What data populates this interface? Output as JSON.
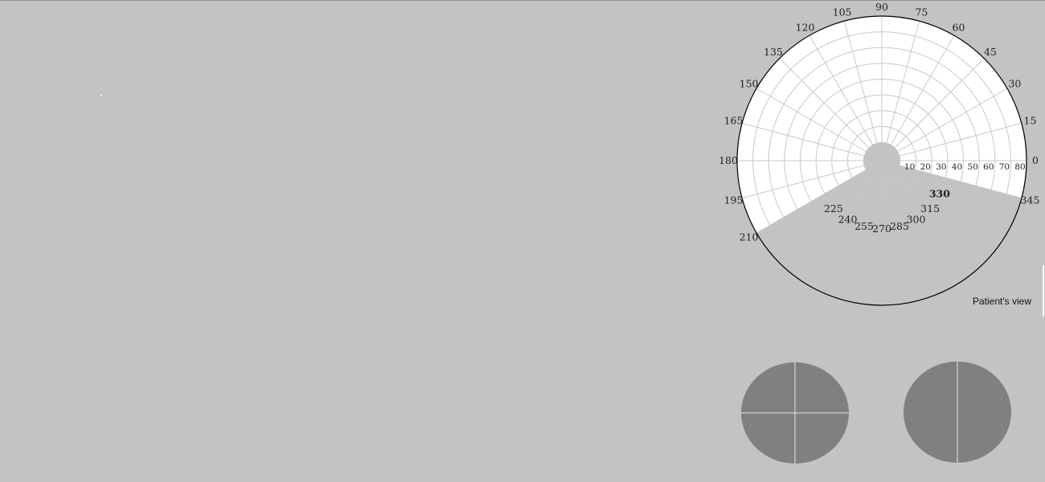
{
  "perimeter": {
    "angle_labels": [
      "0",
      "15",
      "30",
      "45",
      "60",
      "75",
      "90",
      "105",
      "120",
      "135",
      "150",
      "165",
      "180",
      "195",
      "210",
      "225",
      "240",
      "255",
      "270",
      "285",
      "300",
      "315",
      "330",
      "345"
    ],
    "highlighted_angle": "330",
    "radius_labels": [
      "10",
      "20",
      "30",
      "40",
      "50",
      "60",
      "70",
      "80"
    ],
    "view_label": "Patient's view",
    "tested_arc_degrees": [
      210,
      345
    ],
    "colors": {
      "background": "#c3c3c3",
      "field": "#ffffff",
      "grid": "#c8c8c8",
      "rim": "#000000",
      "eye_fill": "#808080"
    }
  },
  "eyes": [
    {
      "name": "left-eye",
      "crosshair": "cross"
    },
    {
      "name": "right-eye",
      "crosshair": "vertical"
    }
  ]
}
